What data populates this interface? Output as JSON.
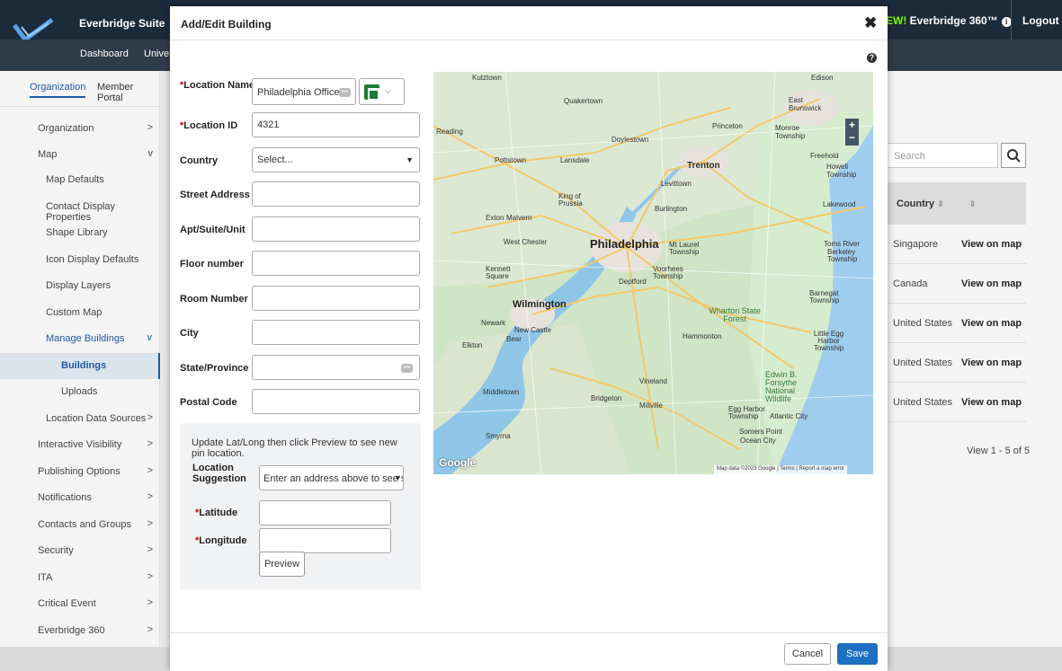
{
  "header": {
    "suite_title": "Everbridge Suite",
    "nav": [
      "Dashboard",
      "Univer"
    ],
    "new_badge": "EW!",
    "product": "Everbridge 360™",
    "logout": "Logout"
  },
  "sidebar": {
    "tabs": [
      "Organization",
      "Member Portal"
    ],
    "items": [
      {
        "label": "Organization",
        "chevron": ">"
      },
      {
        "label": "Map",
        "chevron": "v"
      },
      {
        "label": "Map Defaults"
      },
      {
        "label": "Contact Display Properties"
      },
      {
        "label": "Shape Library"
      },
      {
        "label": "Icon Display Defaults"
      },
      {
        "label": "Display Layers"
      },
      {
        "label": "Custom Map"
      },
      {
        "label": "Manage Buildings",
        "chevron": "v"
      },
      {
        "label": "Buildings"
      },
      {
        "label": "Uploads"
      },
      {
        "label": "Location Data Sources",
        "chevron": ">"
      },
      {
        "label": "Interactive Visibility",
        "chevron": ">"
      },
      {
        "label": "Publishing Options",
        "chevron": ">"
      },
      {
        "label": "Notifications",
        "chevron": ">"
      },
      {
        "label": "Contacts and Groups",
        "chevron": ">"
      },
      {
        "label": "Security",
        "chevron": ">"
      },
      {
        "label": "ITA",
        "chevron": ">"
      },
      {
        "label": "Critical Event",
        "chevron": ">"
      },
      {
        "label": "Everbridge 360",
        "chevron": ">"
      }
    ]
  },
  "background_table": {
    "search_placeholder": "Search",
    "header_country": "Country",
    "rows": [
      {
        "country": "Singapore",
        "action": "View on map"
      },
      {
        "country": "Canada",
        "action": "View on map"
      },
      {
        "country": "United States",
        "action": "View on map"
      },
      {
        "country": "United States",
        "action": "View on map"
      },
      {
        "country": "United States",
        "action": "View on map"
      }
    ],
    "pager": "View 1 - 5 of 5"
  },
  "modal": {
    "title": "Add/Edit Building",
    "close_glyph": "✖",
    "help_glyph": "?",
    "fields": {
      "location_name": {
        "label": "Location Name",
        "value": "Philadelphia Office"
      },
      "location_id": {
        "label": "Location ID",
        "value": "4321"
      },
      "country": {
        "label": "Country",
        "value": "Select..."
      },
      "street_address": {
        "label": "Street Address",
        "value": ""
      },
      "apt": {
        "label": "Apt/Suite/Unit",
        "value": ""
      },
      "floor": {
        "label": "Floor number",
        "value": ""
      },
      "room": {
        "label": "Room Number",
        "value": ""
      },
      "city": {
        "label": "City",
        "value": ""
      },
      "state": {
        "label": "State/Province",
        "value": ""
      },
      "postal": {
        "label": "Postal Code",
        "value": ""
      }
    },
    "latlong": {
      "hint": "Update Lat/Long then click Preview to see new pin location.",
      "suggestion_label_1": "Location",
      "suggestion_label_2": "Suggestion",
      "suggestion_value": "Enter an address above to see suggestions",
      "latitude_label": "Latitude",
      "longitude_label": "Longitude",
      "preview": "Preview"
    },
    "footer": {
      "cancel": "Cancel",
      "save": "Save"
    }
  },
  "map": {
    "labels": [
      "Kutztown",
      "Edison",
      "Quakertown",
      "East Brunswick",
      "Reading",
      "Princeton",
      "Monroe Township",
      "Doylestown",
      "Pottstown",
      "Lansdale",
      "Trenton",
      "Freehold",
      "Howell Township",
      "Levittown",
      "King of Prussia",
      "Burlington",
      "Lakewood",
      "Exton",
      "Malvern",
      "West Chester",
      "Philadelphia",
      "Mt Laurel Township",
      "Toms River",
      "Berkeley Township",
      "Kennett Square",
      "Voorhees Township",
      "Deptford",
      "Wilmington",
      "Barnegat Township",
      "Newark",
      "New Castle",
      "Bear",
      "Elkton",
      "Wharton State Forest",
      "Hammonton",
      "Little Egg Harbor Township",
      "Middletown",
      "Bridgeton",
      "Vineland",
      "Millville",
      "Edwin B. Forsythe National Wildlife",
      "Egg Harbor Township",
      "Atlantic City",
      "Smyrna",
      "Somers Point",
      "Ocean City"
    ],
    "google": "Google",
    "attribution": "Map data ©2023 Google  |  Terms  |  Report a map error",
    "zoom_in": "+",
    "zoom_out": "−"
  },
  "colors": {
    "header_bg": "#1c2b3a",
    "primary": "#1d6fc2",
    "required": "#cc0000"
  }
}
